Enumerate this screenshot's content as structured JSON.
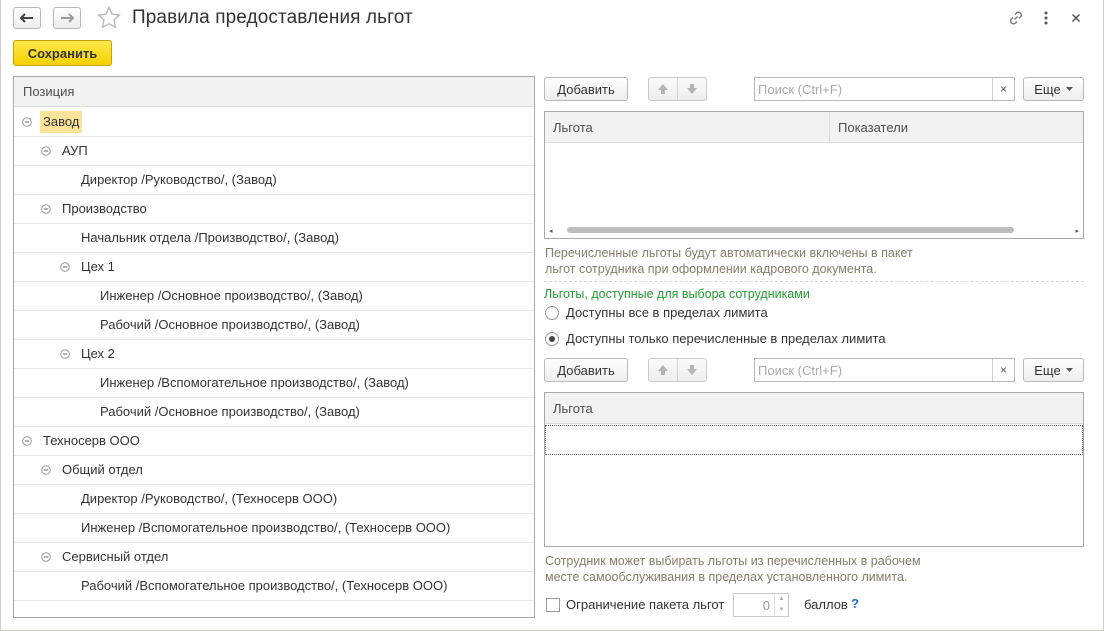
{
  "window": {
    "title": "Правила предоставления льгот",
    "back_icon": "arrow-left-icon",
    "forward_icon": "arrow-right-icon",
    "favorite_icon": "star-icon",
    "link_icon": "link-icon",
    "more_icon": "more-vert-icon",
    "close_icon": "close-icon"
  },
  "toolbar": {
    "save_label": "Сохранить",
    "save_color": "#f7d51d"
  },
  "tree": {
    "header": "Позиция",
    "rows": [
      {
        "label": "Завод",
        "level": 0,
        "toggle": true,
        "selected": true
      },
      {
        "label": "АУП",
        "level": 1,
        "toggle": true
      },
      {
        "label": "Директор /Руководство/, (Завод)",
        "level": 2,
        "toggle": false
      },
      {
        "label": "Производство",
        "level": 1,
        "toggle": true
      },
      {
        "label": "Начальник отдела /Производство/, (Завод)",
        "level": 2,
        "toggle": false
      },
      {
        "label": "Цех 1",
        "level": 2,
        "toggle": true
      },
      {
        "label": "Инженер /Основное производство/, (Завод)",
        "level": 3,
        "toggle": false
      },
      {
        "label": "Рабочий /Основное производство/, (Завод)",
        "level": 3,
        "toggle": false
      },
      {
        "label": "Цех 2",
        "level": 2,
        "toggle": true
      },
      {
        "label": "Инженер /Вспомогательное производство/, (Завод)",
        "level": 3,
        "toggle": false
      },
      {
        "label": "Рабочий /Основное производство/, (Завод)",
        "level": 3,
        "toggle": false
      },
      {
        "label": "Техносерв ООО",
        "level": 0,
        "toggle": true
      },
      {
        "label": "Общий отдел",
        "level": 1,
        "toggle": true
      },
      {
        "label": "Директор /Руководство/, (Техносерв ООО)",
        "level": 2,
        "toggle": false
      },
      {
        "label": "Инженер /Вспомогательное производство/, (Техносерв ООО)",
        "level": 2,
        "toggle": false
      },
      {
        "label": "Сервисный отдел",
        "level": 1,
        "toggle": true
      },
      {
        "label": "Рабочий /Вспомогательное производство/, (Техносерв ООО)",
        "level": 2,
        "toggle": false
      }
    ]
  },
  "top_panel": {
    "add_label": "Добавить",
    "search_placeholder": "Поиск (Ctrl+F)",
    "clear_label": "×",
    "more_label": "Еще",
    "columns": [
      "Льгота",
      "Показатели"
    ],
    "hint_line1": "Перечисленные льготы будут автоматически включены в пакет",
    "hint_line2": "льгот сотрудника при оформлении кадрового документа."
  },
  "choice": {
    "heading": "Льготы, доступные для выбора сотрудниками",
    "option_all": "Доступны все в пределах лимита",
    "option_listed": "Доступны только перечисленные в пределах лимита",
    "selected": "listed"
  },
  "bottom_panel": {
    "add_label": "Добавить",
    "search_placeholder": "Поиск (Ctrl+F)",
    "clear_label": "×",
    "more_label": "Еще",
    "column": "Льгота",
    "hint_line1": "Сотрудник может выбирать льготы из перечисленных в рабочем",
    "hint_line2": "месте самообслуживания в пределах установленного лимита."
  },
  "limit": {
    "checkbox_label": "Ограничение пакета льгот",
    "value": "0",
    "unit": "баллов",
    "help": "?"
  }
}
